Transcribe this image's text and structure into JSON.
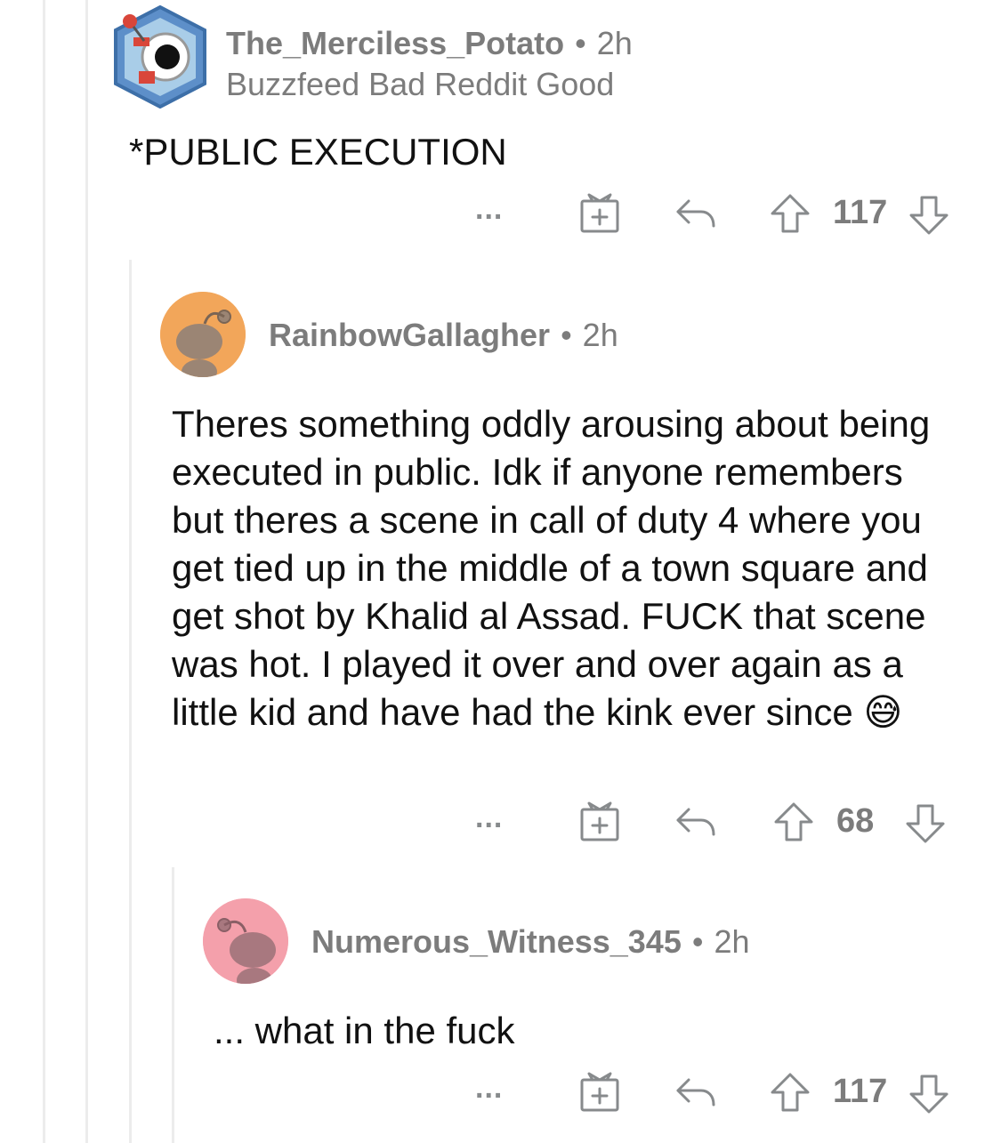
{
  "comments": [
    {
      "username": "The_Merciless_Potato",
      "time": "2h",
      "flair": "Buzzfeed Bad Reddit Good",
      "body": "*PUBLIC EXECUTION",
      "votes": "117",
      "more": "..."
    },
    {
      "username": "RainbowGallagher",
      "time": "2h",
      "body": "Theres something oddly arousing about being executed in public. Idk if anyone remembers but theres a scene in call of duty 4 where you get tied up in the middle of a town square and get shot by Khalid al Assad. FUCK that scene was hot. I played it over and over again as a little kid and have had the kink ever since",
      "emoji": "😅",
      "votes": "68",
      "more": "..."
    },
    {
      "username": "Numerous_Witness_345",
      "time": "2h",
      "body": "... what in the fuck",
      "votes": "117",
      "more": "..."
    }
  ],
  "separator": "•",
  "colors": {
    "avatar1_bg": "#5d8fc9",
    "avatar2_bg": "#f2a65a",
    "avatar3_bg": "#f4a0ab",
    "text_muted": "#7c7c7c",
    "thread_line": "#ececec"
  },
  "icons": [
    "more-icon",
    "award-icon",
    "reply-icon",
    "upvote-icon",
    "downvote-icon"
  ]
}
